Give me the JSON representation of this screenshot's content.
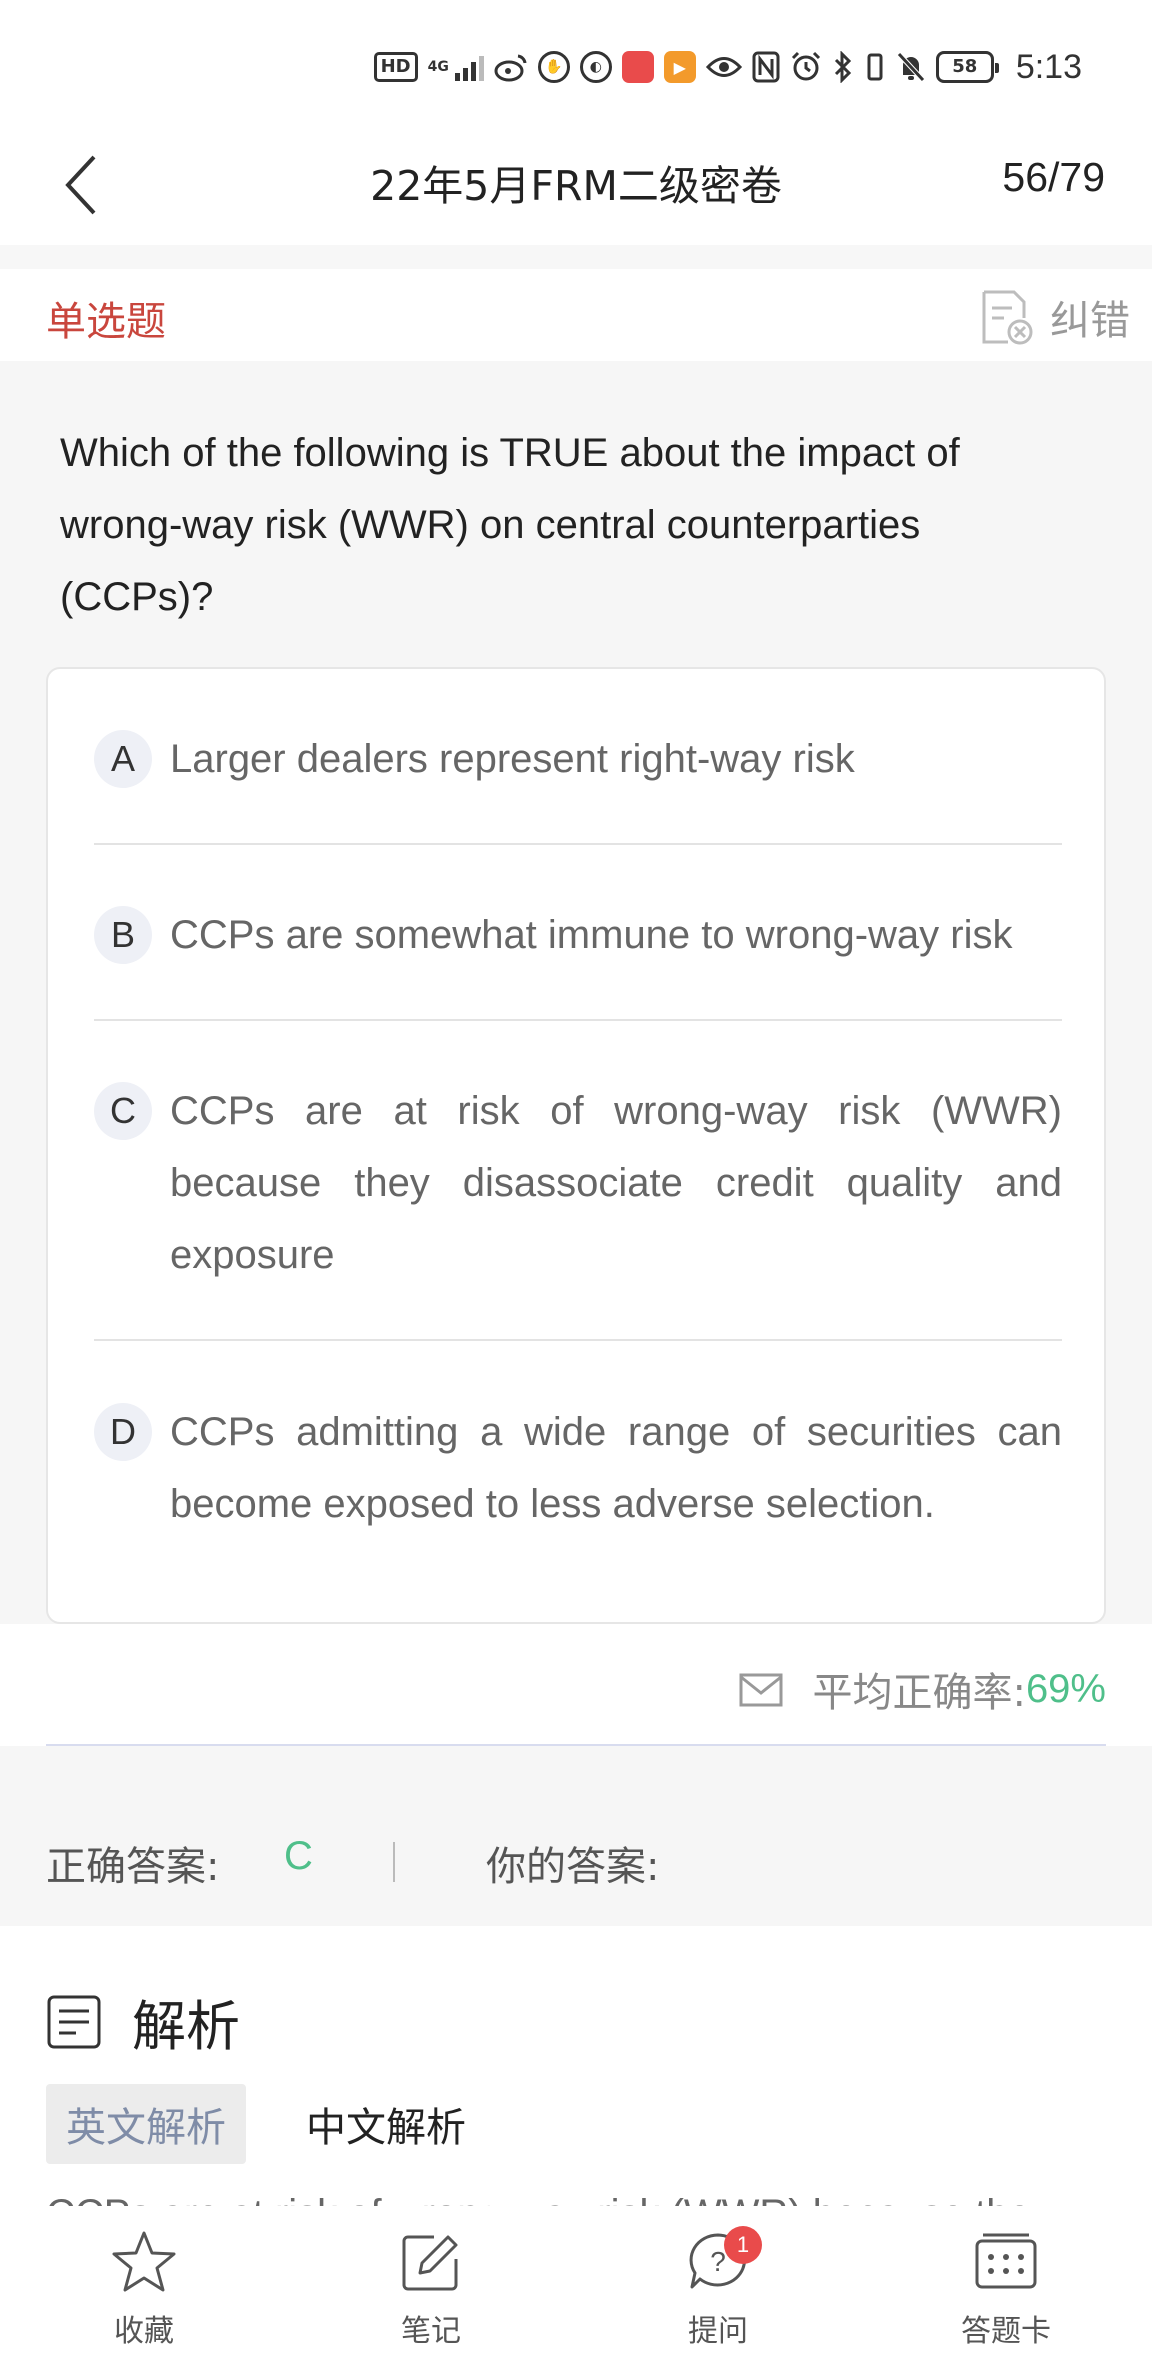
{
  "status_bar": {
    "network": "4G",
    "battery": "58",
    "time": "5:13"
  },
  "header": {
    "title": "22年5月FRM二级密卷",
    "progress": "56/79"
  },
  "question": {
    "type": "单选题",
    "report_label": "纠错",
    "stem": "Which of the following is TRUE about the impact of wrong-way risk (WWR) on central counterparties (CCPs)?",
    "options": [
      {
        "letter": "A",
        "text": "Larger dealers represent right-way risk"
      },
      {
        "letter": "B",
        "text": "CCPs are somewhat immune to wrong-way risk"
      },
      {
        "letter": "C",
        "text": "CCPs are at risk of wrong-way risk (WWR) because they disassociate credit quality and exposure"
      },
      {
        "letter": "D",
        "text": "CCPs admitting a wide range of securities can become exposed to less adverse selection."
      }
    ]
  },
  "stats": {
    "accuracy_label": "平均正确率:",
    "accuracy_value": "69%"
  },
  "answer": {
    "correct_label": "正确答案:",
    "correct_value": "C",
    "yours_label": "你的答案:"
  },
  "analysis": {
    "title": "解析",
    "tabs": [
      "英文解析",
      "中文解析"
    ],
    "active_tab": "英文解析",
    "text_preview": "CCPs are at risk of wrong-way risk (WWR) because they"
  },
  "bottom_nav": [
    {
      "label": "收藏",
      "icon": "star-icon"
    },
    {
      "label": "笔记",
      "icon": "note-edit-icon"
    },
    {
      "label": "提问",
      "icon": "question-bubble-icon",
      "badge": "1"
    },
    {
      "label": "答题卡",
      "icon": "answer-card-icon"
    }
  ],
  "colors": {
    "question_type": "#c9463d",
    "correct": "#4fbf8a",
    "badge": "#e94b4b",
    "tab_active_text": "#7f8ca7"
  }
}
